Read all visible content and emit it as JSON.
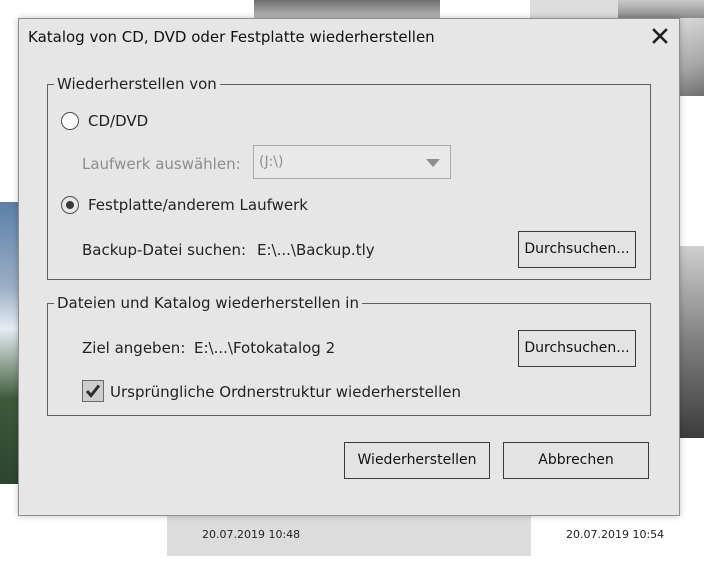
{
  "background": {
    "captions": [
      "20.07.2019 10:48",
      "20.07.2019 10:54"
    ]
  },
  "dialog": {
    "title": "Katalog von CD, DVD oder Festplatte wiederherstellen",
    "close_icon": "close-icon",
    "restore_from": {
      "legend": "Wiederherstellen von",
      "option_cd_dvd": {
        "label": "CD/DVD",
        "selected": false
      },
      "drive_label": "Laufwerk auswählen:",
      "drive_value": "(J:\\)",
      "option_harddisk": {
        "label": "Festplatte/anderem Laufwerk",
        "selected": true
      },
      "backup_label": "Backup-Datei suchen:",
      "backup_path": "E:\\...\\Backup.tly",
      "browse_label": "Durchsuchen..."
    },
    "restore_to": {
      "legend": "Dateien und Katalog wiederherstellen in",
      "target_label": "Ziel angeben:",
      "target_path": "E:\\...\\Fotokatalog 2",
      "browse_label": "Durchsuchen...",
      "keep_structure_label": "Ursprüngliche Ordnerstruktur wiederherstellen",
      "keep_structure_checked": true
    },
    "buttons": {
      "restore": "Wiederherstellen",
      "cancel": "Abbrechen"
    }
  }
}
